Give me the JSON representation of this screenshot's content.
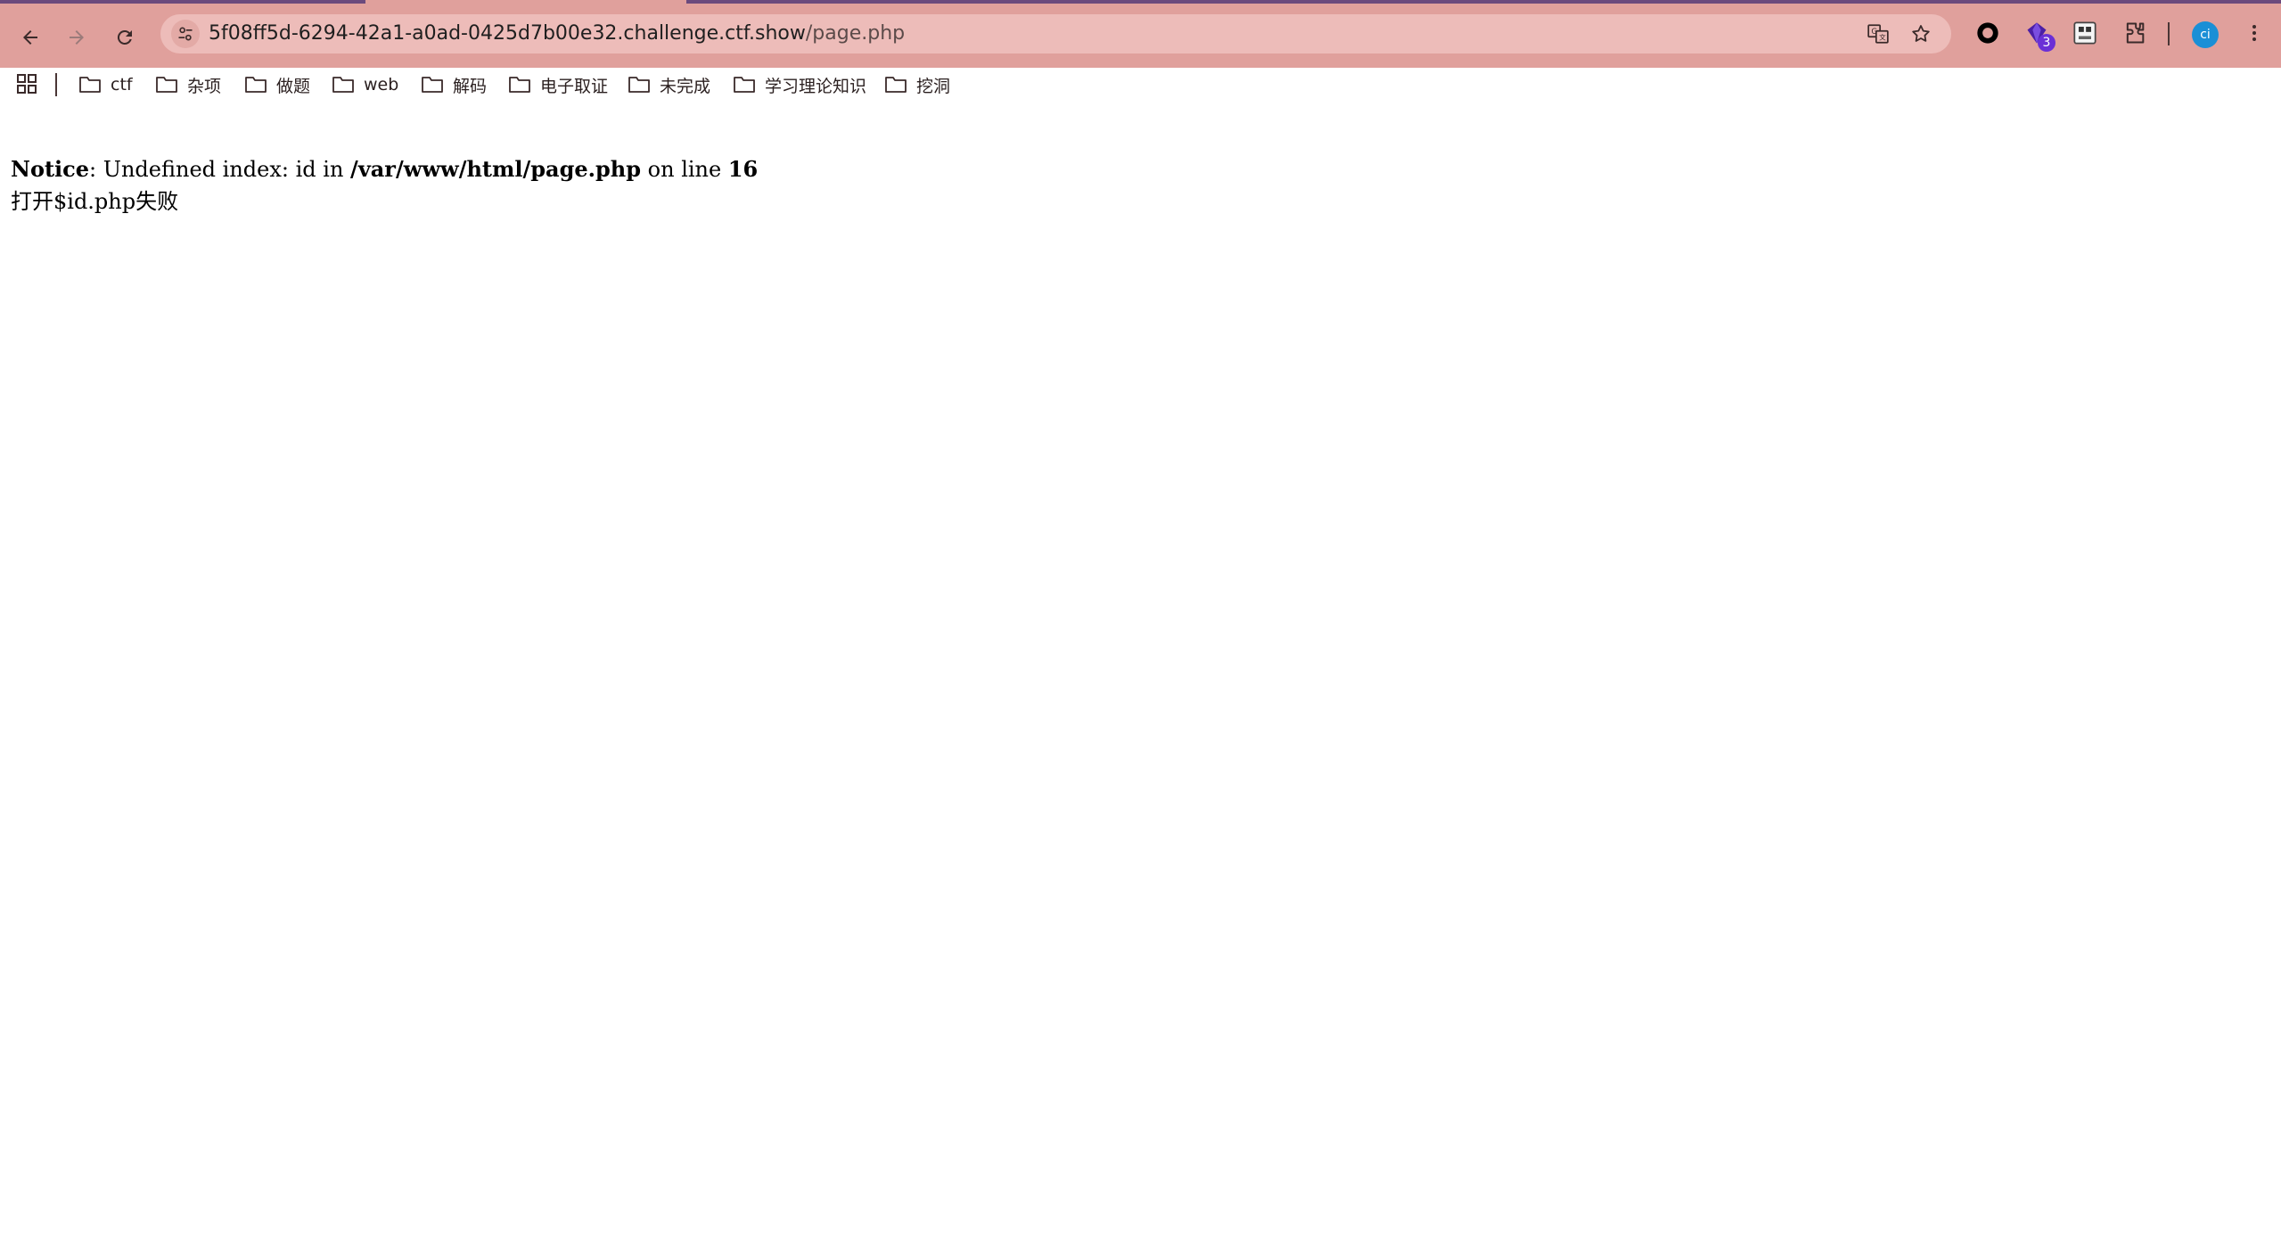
{
  "browser": {
    "url_host": "5f08ff5d-6294-42a1-a0ad-0425d7b00e32.challenge.ctf.show",
    "url_path": "/page.php",
    "extension_badge": "3",
    "avatar_initials": "ci"
  },
  "bookmarks": [
    {
      "label": "ctf"
    },
    {
      "label": "杂项"
    },
    {
      "label": "做题"
    },
    {
      "label": "web"
    },
    {
      "label": "解码"
    },
    {
      "label": "电子取证"
    },
    {
      "label": "未完成"
    },
    {
      "label": "学习理论知识"
    },
    {
      "label": "挖洞"
    }
  ],
  "page": {
    "notice_label": "Notice",
    "notice_text_1": ": Undefined index: id in ",
    "notice_file": "/var/www/html/page.php",
    "notice_text_2": " on line ",
    "notice_line": "16",
    "message": "打开$id.php失败"
  },
  "colors": {
    "toolbar_bg": "#e0a09c",
    "omnibox_bg": "#edbcb9"
  }
}
